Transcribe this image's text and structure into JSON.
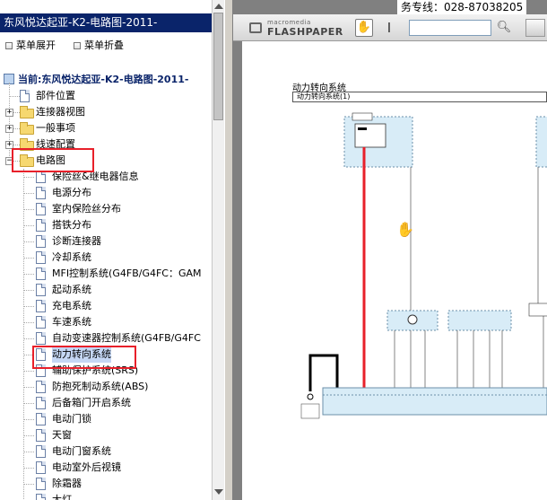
{
  "window": {
    "title": "东风悦达起亚-K2-电路图-2011-"
  },
  "toolbar": {
    "expand_label": "菜单展开",
    "collapse_label": "菜单折叠"
  },
  "tree": {
    "root": "当前:东风悦达起亚-K2-电路图-2011-",
    "nodes": [
      {
        "label": "部件位置",
        "type": "doc"
      },
      {
        "label": "连接器视图",
        "type": "folder"
      },
      {
        "label": "一般事项",
        "type": "folder"
      },
      {
        "label": "线速配置",
        "type": "folder"
      },
      {
        "label": "电路图",
        "type": "folder-open"
      }
    ],
    "children": [
      "保险丝&继电器信息",
      "电源分布",
      "室内保险丝分布",
      "搭铁分布",
      "诊断连接器",
      "冷却系统",
      "MFI控制系统(G4FB/G4FC：GAM",
      "起动系统",
      "充电系统",
      "车速系统",
      "自动变速器控制系统(G4FB/G4FC",
      "动力转向系统",
      "辅助保护系统(SRS)",
      "防抱死制动系统(ABS)",
      "后备箱门开启系统",
      "电动门锁",
      "天窗",
      "电动门窗系统",
      "电动室外后视镜",
      "除霜器",
      "大灯"
    ],
    "selected": "动力转向系统"
  },
  "viewer": {
    "hotline": "务专线：028-87038205",
    "brand_small": "macromedia",
    "brand_big": "FLASHPAPER",
    "doc_title": "动力转向系统",
    "doc_subtitle": "动力转向系统(1)",
    "hand_icon": "hand-tool-icon",
    "text_icon": "text-select-icon",
    "search_icon": "magnifier-icon"
  },
  "colors": {
    "titlebar": "#0a246a",
    "highlight_box": "#e8202a",
    "selection": "#c5d7f4",
    "wire_red": "#e8202a",
    "component_fill": "#d8ecf7"
  }
}
